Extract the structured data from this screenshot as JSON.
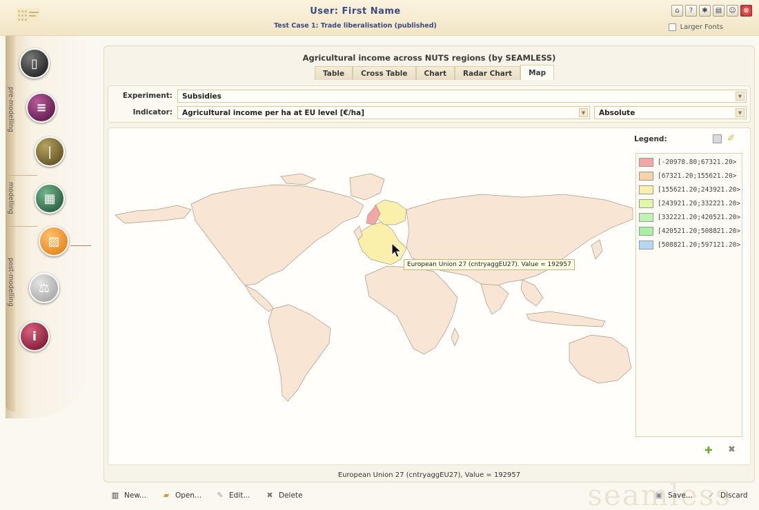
{
  "header": {
    "user_title": "User: First Name",
    "test_case": "Test Case 1: Trade liberalisation (published)",
    "larger_fonts_label": "Larger Fonts",
    "icons": [
      "home-icon",
      "help-icon",
      "settings-icon",
      "book-icon",
      "users-icon",
      "close-icon"
    ]
  },
  "sidebar": {
    "sections": [
      "pre-modelling",
      "modelling",
      "post-modelling"
    ],
    "items": [
      {
        "icon": "clipboard-icon",
        "color": "#111111"
      },
      {
        "icon": "books-icon",
        "color": "#5a1446"
      },
      {
        "icon": "thermometer-icon",
        "color": "#5a4a1c"
      },
      {
        "icon": "calculator-icon",
        "color": "#1f4a30"
      },
      {
        "icon": "chart-icon",
        "color": "#f08a1a",
        "active": true
      },
      {
        "icon": "scales-icon",
        "color": "#a8a8a8"
      },
      {
        "icon": "info-icon",
        "color": "#7a0f2c"
      }
    ]
  },
  "panel": {
    "title": "Agricultural income across NUTS regions (by SEAMLESS)",
    "tabs": [
      "Table",
      "Cross Table",
      "Chart",
      "Radar Chart",
      "Map"
    ],
    "active_tab": "Map",
    "experiment_label": "Experiment:",
    "experiment_value": "Subsidies",
    "indicator_label": "Indicator:",
    "indicator_value": "Agricultural income per ha at EU level [€/ha]",
    "mode_value": "Absolute"
  },
  "map": {
    "tooltip": "European Union 27 (cntryaggEU27). Value = 192957",
    "status": "European Union 27 (cntryaggEU27), Value = 192957",
    "legend_title": "Legend:",
    "legend": [
      {
        "label": "[-20978.80;67321.20>",
        "color": "#f4a6a6"
      },
      {
        "label": "[67321.20;155621.20>",
        "color": "#f9d2aa"
      },
      {
        "label": "[155621.20;243921.20>",
        "color": "#fbefac"
      },
      {
        "label": "[243921.20;332221.20>",
        "color": "#e3f7a9"
      },
      {
        "label": "[332221.20;420521.20>",
        "color": "#bff3b6"
      },
      {
        "label": "[420521.20;508821.20>",
        "color": "#a8f0a4"
      },
      {
        "label": "[508821.20;597121.20>",
        "color": "#b3d8f5"
      }
    ]
  },
  "toolbar": {
    "new": "New...",
    "open": "Open...",
    "edit": "Edit...",
    "delete": "Delete",
    "save": "Save...",
    "discard": "Discard",
    "watermark": "seamless"
  }
}
